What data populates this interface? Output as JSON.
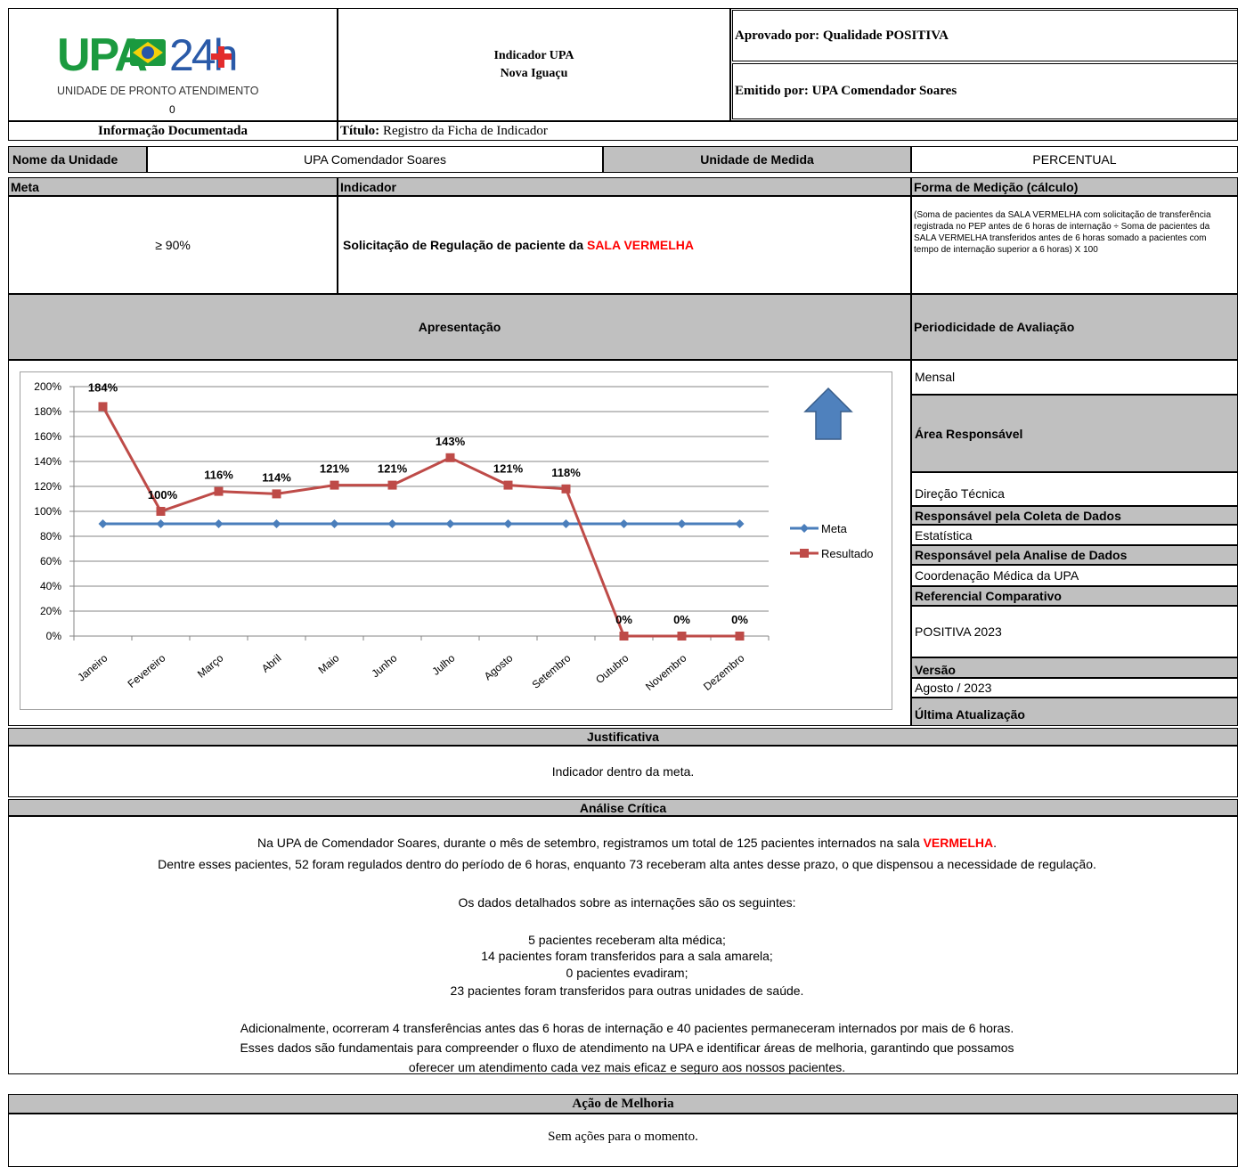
{
  "header": {
    "logo": {
      "upa": "UPA",
      "h24": "24h",
      "subtitle": "UNIDADE DE PRONTO ATENDIMENTO",
      "zero": "0"
    },
    "indicator_line1": "Indicador UPA",
    "indicator_line2": "Nova Iguaçu",
    "approved_by": "Aprovado por: Qualidade POSITIVA",
    "issued_by": "Emitido por: UPA Comendador Soares",
    "doc_info": "Informação Documentada",
    "title_label": "Título:",
    "title_value": "Registro da Ficha de Indicador"
  },
  "unit": {
    "name_label": "Nome da Unidade",
    "name_value": "UPA Comendador Soares",
    "measure_label": "Unidade de Medida",
    "measure_value": "PERCENTUAL"
  },
  "columns": {
    "meta": "Meta",
    "indicador": "Indicador",
    "forma": "Forma de Medição (cálculo)"
  },
  "meta_value": "≥ 90%",
  "indicator": {
    "text": "Solicitação de Regulação de paciente da ",
    "highlight": "SALA VERMELHA"
  },
  "formula": "(Soma de pacientes da SALA VERMELHA com solicitação de transferência registrada no PEP antes de 6 horas de internação ÷ Soma de pacientes da SALA VERMELHA transferidos antes de 6 horas somado a pacientes com tempo de internação superior a 6 horas) X 100",
  "apresentacao": "Apresentação",
  "side": {
    "periodicidade_label": "Periodicidade de Avaliação",
    "periodicidade_value": "Mensal",
    "area_label": "Área Responsável",
    "area_value": "Direção Técnica",
    "coleta_label": "Responsável pela Coleta de Dados",
    "coleta_value": "Estatística",
    "analise_label": "Responsável pela Analise de Dados",
    "analise_value": "Coordenação Médica da UPA",
    "ref_label": "Referencial Comparativo",
    "ref_value": "POSITIVA 2023",
    "versao_label": "Versão",
    "versao_value": "Agosto / 2023",
    "atualizacao_label": "Última Atualização"
  },
  "chart_data": {
    "type": "line",
    "categories": [
      "Janeiro",
      "Fevereiro",
      "Março",
      "Abril",
      "Maio",
      "Junho",
      "Julho",
      "Agosto",
      "Setembro",
      "Outubro",
      "Novembro",
      "Dezembro"
    ],
    "series": [
      {
        "name": "Meta",
        "values": [
          90,
          90,
          90,
          90,
          90,
          90,
          90,
          90,
          90,
          90,
          90,
          90
        ],
        "color": "#4a7ebb"
      },
      {
        "name": "Resultado",
        "values": [
          184,
          100,
          116,
          114,
          121,
          121,
          143,
          121,
          118,
          0,
          0,
          0
        ],
        "color": "#be4b48",
        "labels": [
          "184%",
          "100%",
          "116%",
          "114%",
          "121%",
          "121%",
          "143%",
          "121%",
          "118%",
          "0%",
          "0%",
          "0%"
        ]
      }
    ],
    "ylim": [
      0,
      200
    ],
    "yticks": [
      "0%",
      "20%",
      "40%",
      "60%",
      "80%",
      "100%",
      "120%",
      "140%",
      "160%",
      "180%",
      "200%"
    ],
    "grid": true,
    "legend": "right",
    "arrow": "up-arrow-icon",
    "arrow_color": "#4f81bd"
  },
  "justificativa": {
    "title": "Justificativa",
    "text": "Indicador dentro da meta."
  },
  "analise": {
    "title": "Análise Crítica",
    "p1a": "Na UPA de Comendador Soares, durante o mês de setembro, registramos um total de 125 pacientes internados na sala ",
    "p1b": "VERMELHA",
    "p1c": ".",
    "p2": "Dentre esses pacientes, 52 foram regulados dentro do período de 6 horas, enquanto 73 receberam alta antes desse prazo, o que dispensou a necessidade de regulação.",
    "p3": "Os dados detalhados sobre as internações são os seguintes:",
    "l1": "5 pacientes receberam alta médica;",
    "l2": "14 pacientes foram transferidos para a sala amarela;",
    "l3": "0 pacientes evadiram;",
    "l4": "23 pacientes foram transferidos para outras unidades de saúde.",
    "p4": "Adicionalmente, ocorreram 4 transferências antes das 6 horas de internação e 40 pacientes permaneceram internados por mais de 6 horas.",
    "p5": "Esses dados são fundamentais para compreender o fluxo de atendimento na UPA e identificar áreas de melhoria, garantindo que possamos",
    "p6": "oferecer um atendimento cada vez mais eficaz e seguro aos nossos pacientes."
  },
  "acao": {
    "title": "Ação de Melhoria",
    "text": "Sem ações para o momento."
  }
}
